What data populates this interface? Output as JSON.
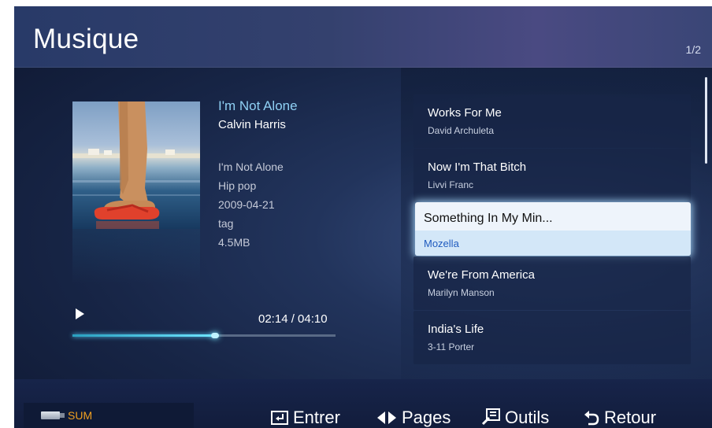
{
  "header": {
    "title": "Musique",
    "page_indicator": "1/2"
  },
  "now_playing": {
    "title": "I'm Not Alone",
    "artist": "Calvin Harris",
    "details": [
      "I'm Not Alone",
      "Hip pop",
      "2009-04-21",
      "tag",
      "4.5MB"
    ],
    "time": "02:14 / 04:10",
    "progress_fraction": 0.55
  },
  "playlist": [
    {
      "title": "Works For Me",
      "artist": "David Archuleta",
      "selected": false
    },
    {
      "title": "Now I'm That Bitch",
      "artist": "Livvi Franc",
      "selected": false
    },
    {
      "title": "Something In My Min...",
      "artist": "Mozella",
      "selected": true
    },
    {
      "title": "We're From America",
      "artist": "Marilyn Manson",
      "selected": false
    },
    {
      "title": "India's Life",
      "artist": "3-11 Porter",
      "selected": false
    }
  ],
  "footer": {
    "usb_label": "SUM",
    "usb_icon": "usb-drive-icon",
    "hints": [
      {
        "icon": "enter-icon",
        "label": "Entrer"
      },
      {
        "icon": "left-right-arrows-icon",
        "label": "Pages"
      },
      {
        "icon": "tools-icon",
        "label": "Outils"
      },
      {
        "icon": "return-icon",
        "label": "Retour"
      }
    ]
  },
  "colors": {
    "accent_cyan": "#6fe6ff",
    "selected_artist": "#1f5bbf",
    "usb_orange": "#f0a020"
  }
}
